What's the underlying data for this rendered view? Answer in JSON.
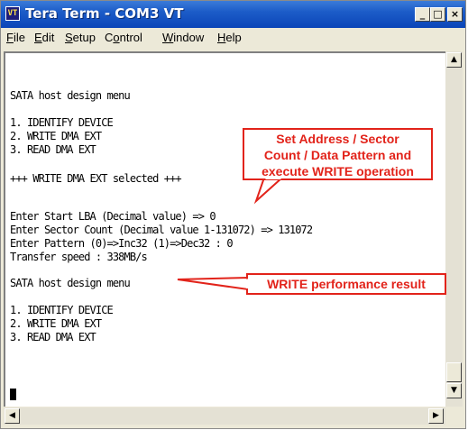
{
  "window": {
    "title": "Tera Term - COM3 VT",
    "app_icon_glyph": "VT",
    "minimize_glyph": "_",
    "maximize_glyph": "□",
    "close_glyph": "×"
  },
  "menu": {
    "items": [
      {
        "access": "F",
        "rest": "ile"
      },
      {
        "access": "E",
        "rest": "dit"
      },
      {
        "access": "S",
        "rest": "etup"
      },
      {
        "pre": "C",
        "access": "o",
        "rest": "ntrol"
      },
      {
        "access": "W",
        "rest": "indow"
      },
      {
        "access": "H",
        "rest": "elp"
      }
    ]
  },
  "terminal": {
    "lines": [
      "SATA host design menu",
      "",
      "1. IDENTIFY DEVICE",
      "2. WRITE DMA EXT",
      "3. READ DMA EXT",
      "",
      "+++ WRITE DMA EXT selected +++",
      "",
      "Enter Start LBA (Decimal value) => 0",
      "Enter Sector Count (Decimal value 1-131072) => 131072",
      "Enter Pattern (0)=>Inc32 (1)=>Dec32 : 0",
      "Transfer speed : 338MB/s",
      "",
      "SATA host design menu",
      "",
      "1. IDENTIFY DEVICE",
      "2. WRITE DMA EXT",
      "3. READ DMA EXT"
    ]
  },
  "scrollbars": {
    "up_glyph": "▲",
    "down_glyph": "▼",
    "left_glyph": "◀",
    "right_glyph": "▶"
  },
  "annotations": {
    "callout_1_lines": [
      "Set Address / Sector",
      "Count / Data Pattern and",
      "execute WRITE operation"
    ],
    "callout_2": "WRITE performance result",
    "color": "#e2231a"
  }
}
